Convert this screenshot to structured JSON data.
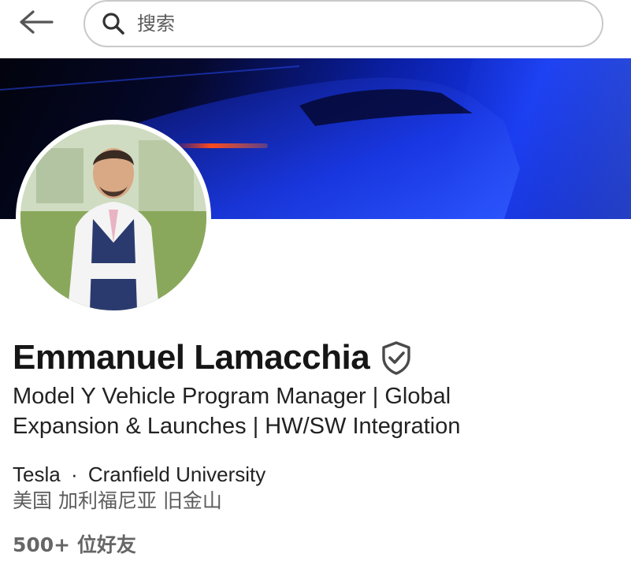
{
  "header": {
    "back_icon": "arrow-left-icon",
    "search": {
      "placeholder": "搜索",
      "icon": "search-icon"
    }
  },
  "profile": {
    "name": "Emmanuel Lamacchia",
    "verified_icon": "verified-shield-icon",
    "headline": "Model Y Vehicle Program Manager | Global Expansion & Launches | HW/SW Integration",
    "company": "Tesla",
    "separator": "·",
    "school": "Cranfield University",
    "location": "美国 加利福尼亚 旧金山",
    "connections": "500+ 位好友"
  },
  "colors": {
    "banner_accent": "#1536f0",
    "text_primary": "#161616",
    "text_secondary": "#5c5c5c"
  }
}
